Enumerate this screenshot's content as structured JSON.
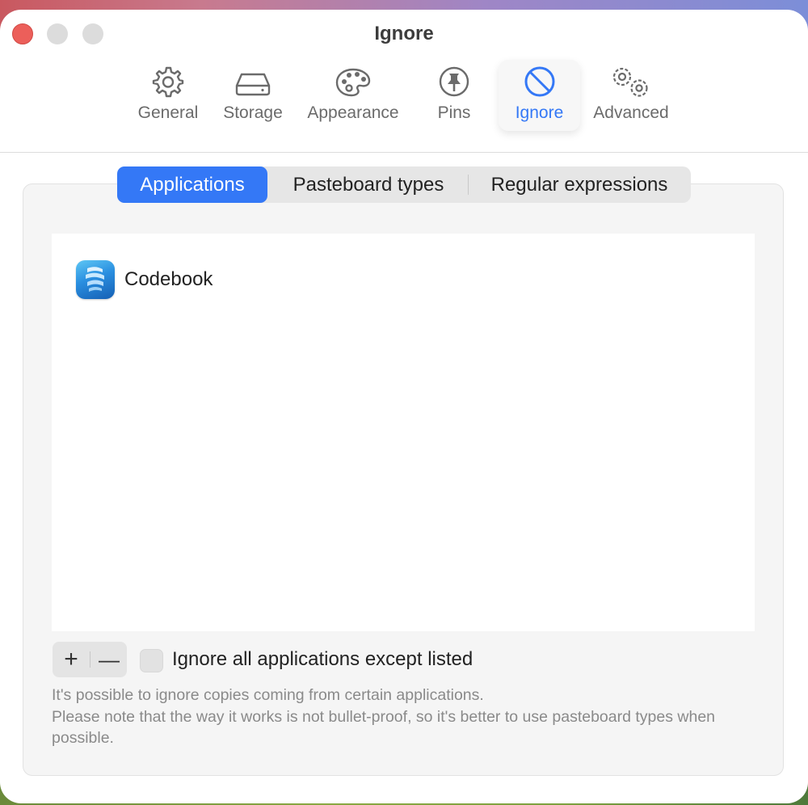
{
  "window": {
    "title": "Ignore"
  },
  "toolbar": {
    "items": [
      {
        "label": "General",
        "icon": "gear-icon"
      },
      {
        "label": "Storage",
        "icon": "storage-drive-icon"
      },
      {
        "label": "Appearance",
        "icon": "palette-icon"
      },
      {
        "label": "Pins",
        "icon": "pin-icon"
      },
      {
        "label": "Ignore",
        "icon": "prohibited-icon",
        "active": true
      },
      {
        "label": "Advanced",
        "icon": "gears-icon"
      }
    ]
  },
  "tabs": {
    "items": [
      "Applications",
      "Pasteboard types",
      "Regular expressions"
    ],
    "selected": "Applications"
  },
  "applications": [
    {
      "name": "Codebook",
      "icon": "codebook-app-icon"
    }
  ],
  "controls": {
    "add_label": "+",
    "remove_label": "—",
    "checkbox_label": "Ignore all applications except listed",
    "checkbox_checked": false
  },
  "help": {
    "line1": "It's possible to ignore copies coming from certain applications.",
    "line2": "Please note that the way it works is not bullet-proof, so it's better to use pasteboard types when possible."
  },
  "colors": {
    "accent": "#3478f6",
    "close": "#ec5f5a"
  }
}
